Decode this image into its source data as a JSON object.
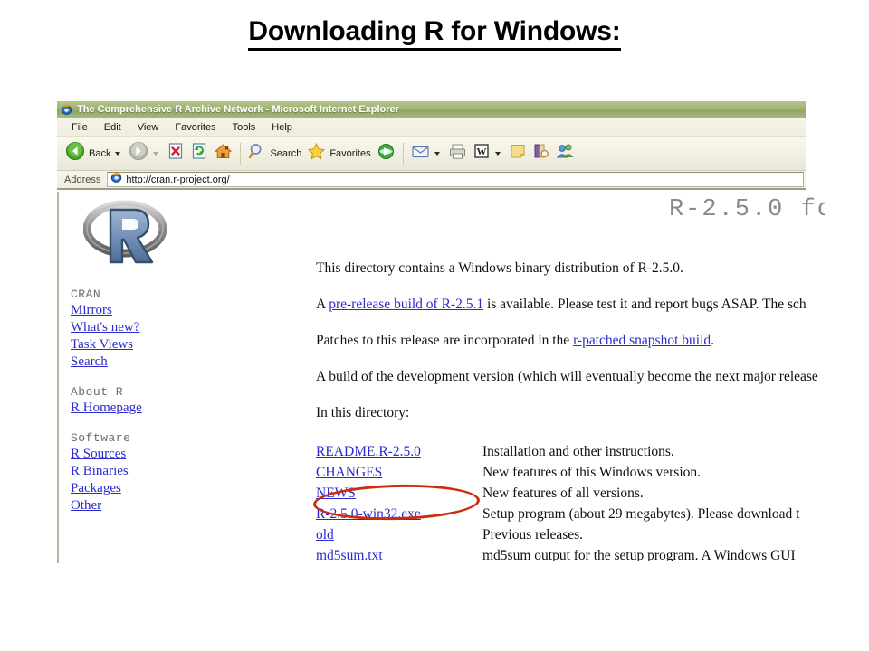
{
  "slide": {
    "title": "Downloading R for Windows:"
  },
  "browser": {
    "window_title": "The Comprehensive R Archive Network - Microsoft Internet Explorer",
    "app_icon": "internet-explorer-icon",
    "menu": [
      "File",
      "Edit",
      "View",
      "Favorites",
      "Tools",
      "Help"
    ],
    "toolbar": {
      "back_label": "Back",
      "forward_label": "",
      "search_label": "Search",
      "favorites_label": "Favorites",
      "icons": [
        "back-arrow-icon",
        "forward-arrow-icon",
        "stop-icon",
        "refresh-icon",
        "home-icon",
        "search-icon",
        "favorites-star-icon",
        "media-icon",
        "mail-icon",
        "print-icon",
        "edit-with-word-icon",
        "notes-icon",
        "research-icon",
        "messenger-icon"
      ]
    },
    "address": {
      "label": "Address",
      "url": "http://cran.r-project.org/",
      "favicon": "page-icon"
    }
  },
  "page": {
    "heading": "R-2.5.0 fo",
    "logo_alt": "r-project-logo",
    "sidebar": [
      {
        "type": "header",
        "label": "CRAN"
      },
      {
        "type": "link",
        "label": "Mirrors"
      },
      {
        "type": "link",
        "label": "What's new?"
      },
      {
        "type": "link",
        "label": "Task Views"
      },
      {
        "type": "link",
        "label": "Search"
      },
      {
        "type": "header",
        "label": "About R"
      },
      {
        "type": "link",
        "label": "R Homepage"
      },
      {
        "type": "header",
        "label": "Software"
      },
      {
        "type": "link",
        "label": "R Sources"
      },
      {
        "type": "link",
        "label": "R Binaries"
      },
      {
        "type": "link",
        "label": "Packages"
      },
      {
        "type": "link",
        "label": "Other"
      }
    ],
    "paragraphs": [
      {
        "before": "This directory contains a Windows binary distribution of R-2.5.0.",
        "link": "",
        "after": ""
      },
      {
        "before": "A ",
        "link": "pre-release build of R-2.5.1",
        "after": " is available. Please test it and report bugs ASAP. The sch"
      },
      {
        "before": "Patches to this release are incorporated in the ",
        "link": "r-patched snapshot build",
        "after": "."
      },
      {
        "before": "A build of the development version (which will eventually become the next major release ",
        "link": "",
        "after": ""
      },
      {
        "before": "In this directory:",
        "link": "",
        "after": ""
      }
    ],
    "files": [
      {
        "name": "README.R-2.5.0",
        "desc": "Installation and other instructions."
      },
      {
        "name": "CHANGES",
        "desc": "New features of this Windows version."
      },
      {
        "name": "NEWS",
        "desc": "New features of all versions."
      },
      {
        "name": "R-2.5.0-win32.exe",
        "desc": "Setup program (about 29 megabytes). Please download t"
      },
      {
        "name": "old",
        "desc": "Previous releases."
      },
      {
        "name": "md5sum.txt",
        "desc": "md5sum output for the setup program.  A Windows GUI"
      }
    ],
    "annotation": {
      "shape": "red-oval",
      "target": "R-2.5.0-win32.exe",
      "color": "#cc2b10"
    }
  }
}
